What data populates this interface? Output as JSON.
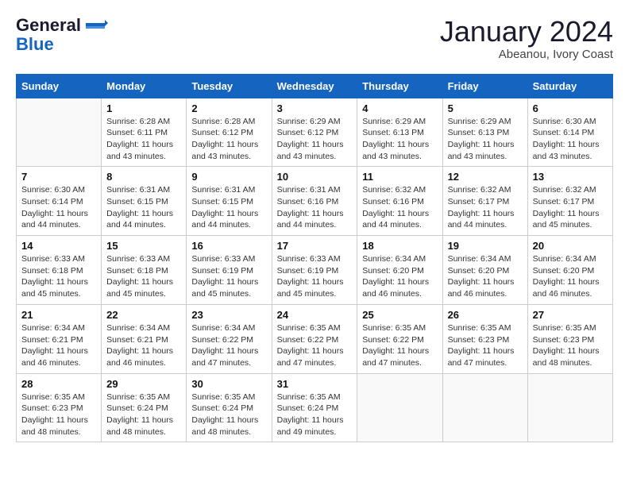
{
  "logo": {
    "line1": "General",
    "line2": "Blue"
  },
  "title": "January 2024",
  "location": "Abeanou, Ivory Coast",
  "days_of_week": [
    "Sunday",
    "Monday",
    "Tuesday",
    "Wednesday",
    "Thursday",
    "Friday",
    "Saturday"
  ],
  "weeks": [
    [
      {
        "day": "",
        "info": ""
      },
      {
        "day": "1",
        "info": "Sunrise: 6:28 AM\nSunset: 6:11 PM\nDaylight: 11 hours\nand 43 minutes."
      },
      {
        "day": "2",
        "info": "Sunrise: 6:28 AM\nSunset: 6:12 PM\nDaylight: 11 hours\nand 43 minutes."
      },
      {
        "day": "3",
        "info": "Sunrise: 6:29 AM\nSunset: 6:12 PM\nDaylight: 11 hours\nand 43 minutes."
      },
      {
        "day": "4",
        "info": "Sunrise: 6:29 AM\nSunset: 6:13 PM\nDaylight: 11 hours\nand 43 minutes."
      },
      {
        "day": "5",
        "info": "Sunrise: 6:29 AM\nSunset: 6:13 PM\nDaylight: 11 hours\nand 43 minutes."
      },
      {
        "day": "6",
        "info": "Sunrise: 6:30 AM\nSunset: 6:14 PM\nDaylight: 11 hours\nand 43 minutes."
      }
    ],
    [
      {
        "day": "7",
        "info": "Sunrise: 6:30 AM\nSunset: 6:14 PM\nDaylight: 11 hours\nand 44 minutes."
      },
      {
        "day": "8",
        "info": "Sunrise: 6:31 AM\nSunset: 6:15 PM\nDaylight: 11 hours\nand 44 minutes."
      },
      {
        "day": "9",
        "info": "Sunrise: 6:31 AM\nSunset: 6:15 PM\nDaylight: 11 hours\nand 44 minutes."
      },
      {
        "day": "10",
        "info": "Sunrise: 6:31 AM\nSunset: 6:16 PM\nDaylight: 11 hours\nand 44 minutes."
      },
      {
        "day": "11",
        "info": "Sunrise: 6:32 AM\nSunset: 6:16 PM\nDaylight: 11 hours\nand 44 minutes."
      },
      {
        "day": "12",
        "info": "Sunrise: 6:32 AM\nSunset: 6:17 PM\nDaylight: 11 hours\nand 44 minutes."
      },
      {
        "day": "13",
        "info": "Sunrise: 6:32 AM\nSunset: 6:17 PM\nDaylight: 11 hours\nand 45 minutes."
      }
    ],
    [
      {
        "day": "14",
        "info": "Sunrise: 6:33 AM\nSunset: 6:18 PM\nDaylight: 11 hours\nand 45 minutes."
      },
      {
        "day": "15",
        "info": "Sunrise: 6:33 AM\nSunset: 6:18 PM\nDaylight: 11 hours\nand 45 minutes."
      },
      {
        "day": "16",
        "info": "Sunrise: 6:33 AM\nSunset: 6:19 PM\nDaylight: 11 hours\nand 45 minutes."
      },
      {
        "day": "17",
        "info": "Sunrise: 6:33 AM\nSunset: 6:19 PM\nDaylight: 11 hours\nand 45 minutes."
      },
      {
        "day": "18",
        "info": "Sunrise: 6:34 AM\nSunset: 6:20 PM\nDaylight: 11 hours\nand 46 minutes."
      },
      {
        "day": "19",
        "info": "Sunrise: 6:34 AM\nSunset: 6:20 PM\nDaylight: 11 hours\nand 46 minutes."
      },
      {
        "day": "20",
        "info": "Sunrise: 6:34 AM\nSunset: 6:20 PM\nDaylight: 11 hours\nand 46 minutes."
      }
    ],
    [
      {
        "day": "21",
        "info": "Sunrise: 6:34 AM\nSunset: 6:21 PM\nDaylight: 11 hours\nand 46 minutes."
      },
      {
        "day": "22",
        "info": "Sunrise: 6:34 AM\nSunset: 6:21 PM\nDaylight: 11 hours\nand 46 minutes."
      },
      {
        "day": "23",
        "info": "Sunrise: 6:34 AM\nSunset: 6:22 PM\nDaylight: 11 hours\nand 47 minutes."
      },
      {
        "day": "24",
        "info": "Sunrise: 6:35 AM\nSunset: 6:22 PM\nDaylight: 11 hours\nand 47 minutes."
      },
      {
        "day": "25",
        "info": "Sunrise: 6:35 AM\nSunset: 6:22 PM\nDaylight: 11 hours\nand 47 minutes."
      },
      {
        "day": "26",
        "info": "Sunrise: 6:35 AM\nSunset: 6:23 PM\nDaylight: 11 hours\nand 47 minutes."
      },
      {
        "day": "27",
        "info": "Sunrise: 6:35 AM\nSunset: 6:23 PM\nDaylight: 11 hours\nand 48 minutes."
      }
    ],
    [
      {
        "day": "28",
        "info": "Sunrise: 6:35 AM\nSunset: 6:23 PM\nDaylight: 11 hours\nand 48 minutes."
      },
      {
        "day": "29",
        "info": "Sunrise: 6:35 AM\nSunset: 6:24 PM\nDaylight: 11 hours\nand 48 minutes."
      },
      {
        "day": "30",
        "info": "Sunrise: 6:35 AM\nSunset: 6:24 PM\nDaylight: 11 hours\nand 48 minutes."
      },
      {
        "day": "31",
        "info": "Sunrise: 6:35 AM\nSunset: 6:24 PM\nDaylight: 11 hours\nand 49 minutes."
      },
      {
        "day": "",
        "info": ""
      },
      {
        "day": "",
        "info": ""
      },
      {
        "day": "",
        "info": ""
      }
    ]
  ]
}
